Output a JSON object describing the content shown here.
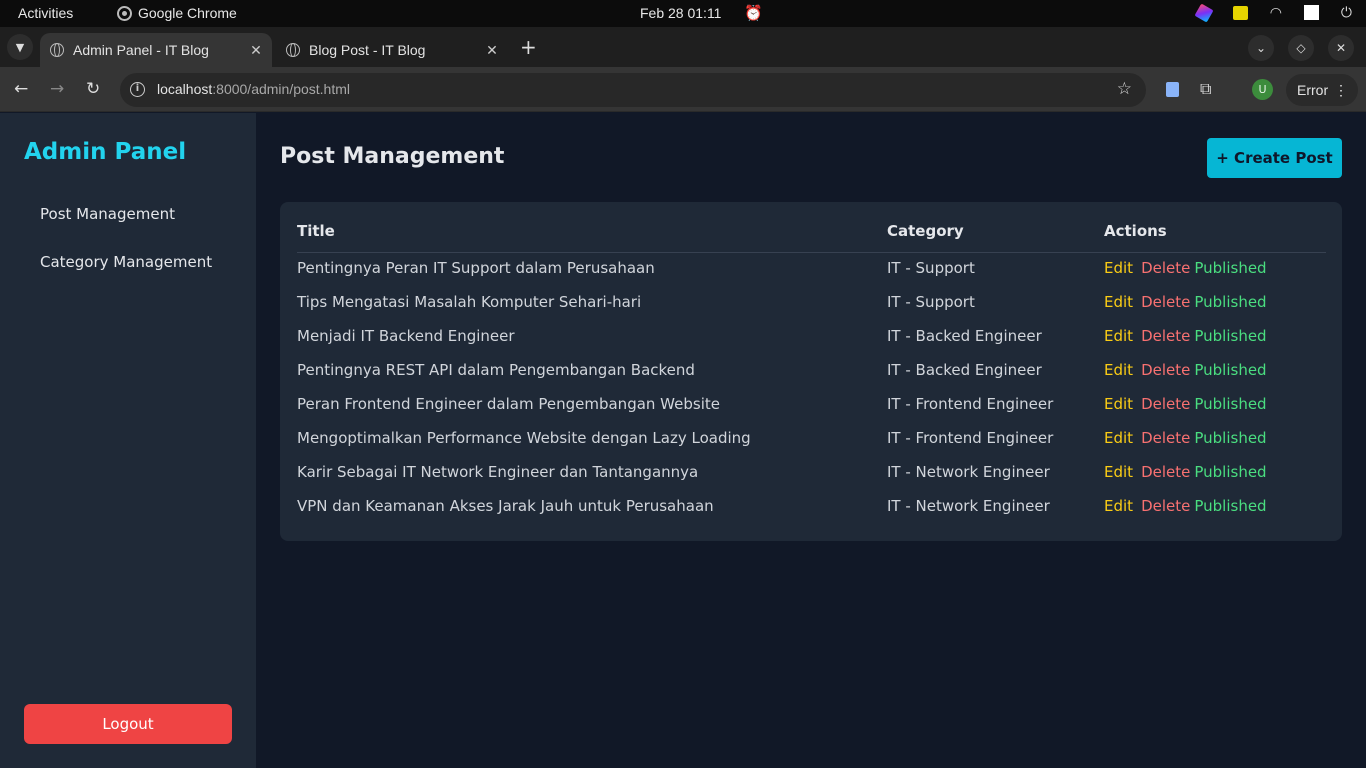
{
  "os": {
    "activities": "Activities",
    "app_name": "Google Chrome",
    "clock": "Feb 28  01:11"
  },
  "browser": {
    "tabs": [
      {
        "label": "Admin Panel - IT Blog",
        "active": true
      },
      {
        "label": "Blog Post - IT Blog",
        "active": false
      }
    ],
    "url_host": "localhost",
    "url_rest": ":8000/admin/post.html",
    "profile_initial": "U",
    "status_label": "Error"
  },
  "sidebar": {
    "brand": "Admin Panel",
    "links": [
      "Post Management",
      "Category Management"
    ],
    "logout": "Logout"
  },
  "main": {
    "title": "Post Management",
    "create_label": "+ Create Post",
    "columns": [
      "Title",
      "Category",
      "Actions"
    ],
    "action_labels": {
      "edit": "Edit",
      "delete": "Delete",
      "status": "Published"
    },
    "rows": [
      {
        "title": "Pentingnya Peran IT Support dalam Perusahaan",
        "category": "IT - Support"
      },
      {
        "title": "Tips Mengatasi Masalah Komputer Sehari-hari",
        "category": "IT - Support"
      },
      {
        "title": "Menjadi IT Backend Engineer",
        "category": "IT - Backed Engineer"
      },
      {
        "title": "Pentingnya REST API dalam Pengembangan Backend",
        "category": "IT - Backed Engineer"
      },
      {
        "title": "Peran Frontend Engineer dalam Pengembangan Website",
        "category": "IT - Frontend Engineer"
      },
      {
        "title": "Mengoptimalkan Performance Website dengan Lazy Loading",
        "category": "IT - Frontend Engineer"
      },
      {
        "title": "Karir Sebagai IT Network Engineer dan Tantangannya",
        "category": "IT - Network Engineer"
      },
      {
        "title": "VPN dan Keamanan Akses Jarak Jauh untuk Perusahaan",
        "category": "IT - Network Engineer"
      }
    ]
  },
  "colors": {
    "brand": "#22d3ee",
    "create_button": "#06b6d4",
    "logout_button": "#ef4444",
    "edit": "#facc15",
    "delete": "#f87171",
    "published": "#4ade80"
  }
}
